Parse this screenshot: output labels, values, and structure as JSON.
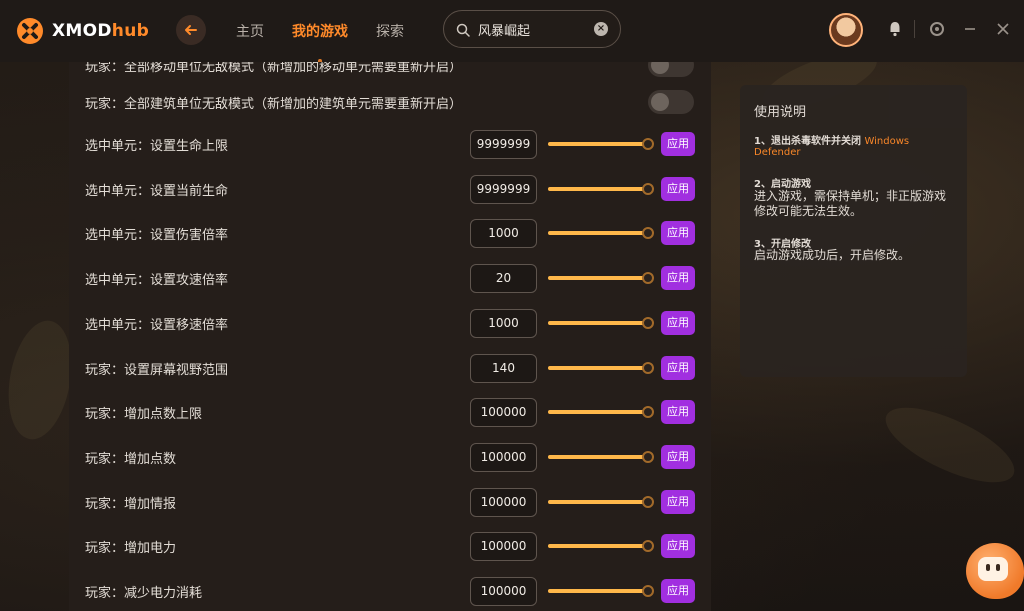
{
  "app": {
    "logo_text_a": "XMOD",
    "logo_text_b": "hub",
    "brand_color": "#ff8a2a"
  },
  "nav": {
    "items": [
      {
        "label": "主页",
        "active": false
      },
      {
        "label": "我的游戏",
        "active": true
      },
      {
        "label": "探索",
        "active": false
      }
    ]
  },
  "search": {
    "value": "风暴崛起"
  },
  "partial_row": {
    "label": "玩家：全部移动单位无敌模式（新增加的移动单元需要重新开启）"
  },
  "toggle_row": {
    "label": "玩家：全部建筑单位无敌模式（新增加的建筑单元需要重新开启）",
    "enabled": false
  },
  "rows": [
    {
      "label": "选中单元：设置生命上限",
      "value": "9999999",
      "apply": "应用"
    },
    {
      "label": "选中单元：设置当前生命",
      "value": "9999999",
      "apply": "应用"
    },
    {
      "label": "选中单元：设置伤害倍率",
      "value": "1000",
      "apply": "应用"
    },
    {
      "label": "选中单元：设置攻速倍率",
      "value": "20",
      "apply": "应用"
    },
    {
      "label": "选中单元：设置移速倍率",
      "value": "1000",
      "apply": "应用"
    },
    {
      "label": "玩家：设置屏幕视野范围",
      "value": "140",
      "apply": "应用"
    },
    {
      "label": "玩家：增加点数上限",
      "value": "100000",
      "apply": "应用"
    },
    {
      "label": "玩家：增加点数",
      "value": "100000",
      "apply": "应用"
    },
    {
      "label": "玩家：增加情报",
      "value": "100000",
      "apply": "应用"
    },
    {
      "label": "玩家：增加电力",
      "value": "100000",
      "apply": "应用"
    },
    {
      "label": "玩家：减少电力消耗",
      "value": "100000",
      "apply": "应用"
    }
  ],
  "instructions": {
    "title": "使用说明",
    "step1_head": "1、退出杀毒软件并关闭",
    "step1_highlight_a": "Windows",
    "step1_highlight_b": "Defender",
    "step2_head": "2、启动游戏",
    "step2_body": "进入游戏，需保持单机；非正版游戏修改可能无法生效。",
    "step3_head": "3、开启修改",
    "step3_body": "启动游戏成功后，开启修改。"
  }
}
